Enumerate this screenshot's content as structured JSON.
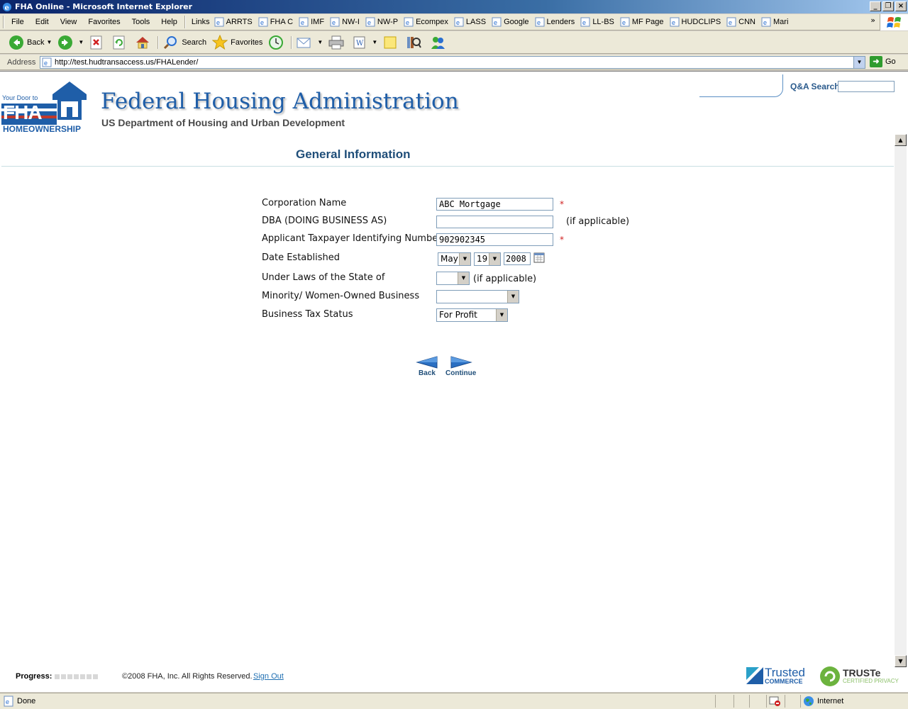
{
  "window": {
    "title": "FHA Online - Microsoft Internet Explorer"
  },
  "menu": {
    "file": "File",
    "edit": "Edit",
    "view": "View",
    "favorites": "Favorites",
    "tools": "Tools",
    "help": "Help"
  },
  "links": {
    "label": "Links",
    "items": [
      "ARRTS",
      "FHA C",
      "IMF",
      "NW-I",
      "NW-P",
      "Ecompex",
      "LASS",
      "Google",
      "Lenders",
      "LL-BS",
      "MF Page",
      "HUDCLIPS",
      "CNN",
      "Mari"
    ],
    "overflow": "»"
  },
  "toolbar": {
    "back": "Back",
    "search": "Search",
    "favorites": "Favorites"
  },
  "address": {
    "label": "Address",
    "url": "http://test.hudtransaccess.us/FHALender/",
    "go": "Go"
  },
  "header": {
    "logo_top": "Your Door to",
    "logo_main": "FHA",
    "logo_bottom": "HOMEOWNERSHIP",
    "title": "Federal Housing Administration",
    "subtitle": "US Department of Housing and Urban Development",
    "qa_label": "Q&A Search:"
  },
  "page": {
    "heading": "General Information"
  },
  "form": {
    "corporation_name": {
      "label": "Corporation Name",
      "value": "ABC Mortgage",
      "required": "*"
    },
    "dba": {
      "label": "DBA (DOING BUSINESS AS)",
      "value": "",
      "hint": "(if applicable)"
    },
    "tin": {
      "label": "Applicant Taxpayer Identifying Number",
      "value": "902902345",
      "required": "*"
    },
    "date_established": {
      "label": "Date Established",
      "month": "May",
      "day": "19",
      "year": "2008"
    },
    "state_laws": {
      "label": "Under Laws of the State of",
      "value": "",
      "hint": "(if applicable)"
    },
    "minority": {
      "label": "Minority/ Women-Owned Business",
      "value": ""
    },
    "tax_status": {
      "label": "Business Tax Status",
      "value": "For Profit"
    }
  },
  "nav": {
    "back": "Back",
    "continue": "Continue"
  },
  "footer": {
    "progress_label": "Progress:",
    "copyright": "©2008 FHA, Inc. All Rights Reserved.",
    "signout": "Sign Out",
    "trusted": "Trusted",
    "commerce": "COMMERCE",
    "truste": "TRUSTe",
    "truste_sub": "CERTIFIED PRIVACY"
  },
  "status": {
    "text": "Done",
    "zone": "Internet"
  },
  "colors": {
    "brand": "#1f5ea8",
    "heading": "#1f4e79",
    "required": "#d02020",
    "title_bar": "#0a246a"
  }
}
